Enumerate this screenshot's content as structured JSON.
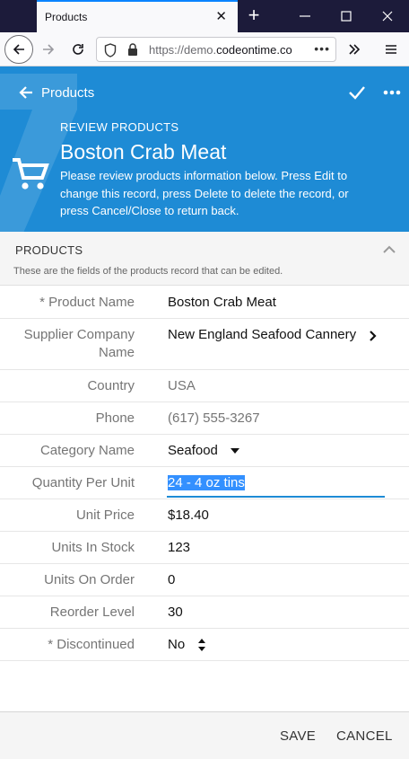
{
  "browser": {
    "tab_title": "Products",
    "tab_close": "✕",
    "new_tab": "+",
    "url_prefix": "https://demo.",
    "url_domain": "codeontime.co",
    "url_more": "•••"
  },
  "header": {
    "back_label": "Products",
    "subtitle": "REVIEW PRODUCTS",
    "title": "Boston Crab Meat",
    "description": "Please review products information below. Press Edit to change this record, press Delete to delete the record, or press Cancel/Close to return back.",
    "color": "#1e8bd5"
  },
  "section": {
    "title": "PRODUCTS",
    "description": "These are the fields of the products record that can be edited."
  },
  "fields": {
    "product_name": {
      "label": "* Product Name",
      "value": "Boston Crab Meat"
    },
    "supplier": {
      "label": "Supplier Company Name",
      "value": "New England Seafood Cannery"
    },
    "country": {
      "label": "Country",
      "value": "USA"
    },
    "phone": {
      "label": "Phone",
      "value": "(617) 555-3267"
    },
    "category": {
      "label": "Category Name",
      "value": "Seafood"
    },
    "quantity": {
      "label": "Quantity Per Unit",
      "value": "24 - 4 oz tins"
    },
    "unit_price": {
      "label": "Unit Price",
      "value": "$18.40"
    },
    "units_in_stock": {
      "label": "Units In Stock",
      "value": "123"
    },
    "units_on_order": {
      "label": "Units On Order",
      "value": "0"
    },
    "reorder_level": {
      "label": "Reorder Level",
      "value": "30"
    },
    "discontinued": {
      "label": "* Discontinued",
      "value": "No"
    }
  },
  "footer": {
    "save_label": "SAVE",
    "cancel_label": "CANCEL"
  }
}
